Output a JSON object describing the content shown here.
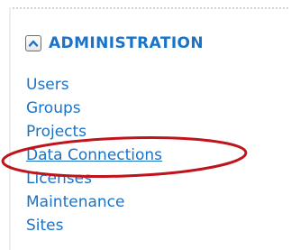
{
  "administration": {
    "title": "ADMINISTRATION",
    "toggle_icon": "chevron-up-icon",
    "items": [
      {
        "label": "Users"
      },
      {
        "label": "Groups"
      },
      {
        "label": "Projects"
      },
      {
        "label": "Data Connections",
        "active": true
      },
      {
        "label": "Licenses"
      },
      {
        "label": "Maintenance"
      },
      {
        "label": "Sites"
      }
    ]
  },
  "colors": {
    "link": "#1a73c8",
    "highlight": "#c0141c"
  }
}
